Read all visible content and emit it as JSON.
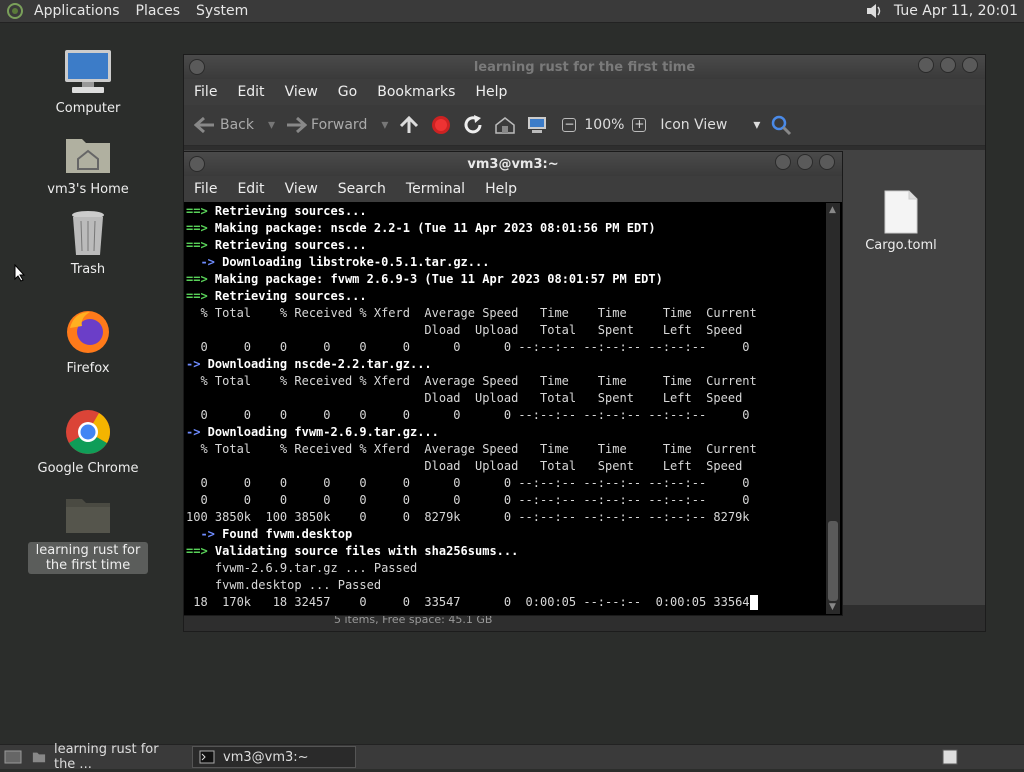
{
  "top_panel": {
    "menus": [
      "Applications",
      "Places",
      "System"
    ],
    "clock": "Tue Apr 11, 20:01"
  },
  "desktop": {
    "icons": [
      {
        "label": "Computer"
      },
      {
        "label": "vm3's Home"
      },
      {
        "label": "Trash"
      },
      {
        "label": "Firefox"
      },
      {
        "label": "Google Chrome"
      },
      {
        "label": "learning rust for the first time"
      }
    ]
  },
  "file_manager": {
    "title": "learning rust for the first time",
    "menu": [
      "File",
      "Edit",
      "View",
      "Go",
      "Bookmarks",
      "Help"
    ],
    "toolbar": {
      "back": "Back",
      "forward": "Forward",
      "zoom": "100%",
      "view_mode": "Icon View"
    },
    "files": [
      {
        "name": "Cargo.toml"
      }
    ],
    "status": "5 items, Free space: 45.1 GB"
  },
  "terminal": {
    "title": "vm3@vm3:~",
    "menu": [
      "File",
      "Edit",
      "View",
      "Search",
      "Terminal",
      "Help"
    ],
    "lines": [
      {
        "prefix": "==>",
        "style": "g",
        "text": " Retrieving sources...",
        "bold": true
      },
      {
        "prefix": "==>",
        "style": "g",
        "text": " Making package: nscde 2.2-1 (Tue 11 Apr 2023 08:01:56 PM EDT)",
        "bold": true
      },
      {
        "prefix": "==>",
        "style": "g",
        "text": " Retrieving sources...",
        "bold": true
      },
      {
        "prefix": "  ->",
        "style": "b",
        "text": " Downloading libstroke-0.5.1.tar.gz...",
        "bold": true
      },
      {
        "prefix": "==>",
        "style": "g",
        "text": " Making package: fvwm 2.6.9-3 (Tue 11 Apr 2023 08:01:57 PM EDT)",
        "bold": true
      },
      {
        "prefix": "==>",
        "style": "g",
        "text": " Retrieving sources...",
        "bold": true
      },
      {
        "prefix": "",
        "style": "",
        "text": "  % Total    % Received % Xferd  Average Speed   Time    Time     Time  Current",
        "bold": false
      },
      {
        "prefix": "",
        "style": "",
        "text": "                                 Dload  Upload   Total   Spent    Left  Speed",
        "bold": false
      },
      {
        "prefix": "",
        "style": "",
        "text": "  0     0    0     0    0     0      0      0 --:--:-- --:--:-- --:--:--     0",
        "bold": false
      },
      {
        "prefix": "->",
        "style": "b",
        "text": " Downloading nscde-2.2.tar.gz...",
        "bold": true
      },
      {
        "prefix": "",
        "style": "",
        "text": "  % Total    % Received % Xferd  Average Speed   Time    Time     Time  Current",
        "bold": false
      },
      {
        "prefix": "",
        "style": "",
        "text": "                                 Dload  Upload   Total   Spent    Left  Speed",
        "bold": false
      },
      {
        "prefix": "",
        "style": "",
        "text": "  0     0    0     0    0     0      0      0 --:--:-- --:--:-- --:--:--     0",
        "bold": false
      },
      {
        "prefix": "->",
        "style": "b",
        "text": " Downloading fvwm-2.6.9.tar.gz...",
        "bold": true
      },
      {
        "prefix": "",
        "style": "",
        "text": "  % Total    % Received % Xferd  Average Speed   Time    Time     Time  Current",
        "bold": false
      },
      {
        "prefix": "",
        "style": "",
        "text": "                                 Dload  Upload   Total   Spent    Left  Speed",
        "bold": false
      },
      {
        "prefix": "",
        "style": "",
        "text": "  0     0    0     0    0     0      0      0 --:--:-- --:--:-- --:--:--     0",
        "bold": false
      },
      {
        "prefix": "",
        "style": "",
        "text": "  0     0    0     0    0     0      0      0 --:--:-- --:--:-- --:--:--     0",
        "bold": false
      },
      {
        "prefix": "",
        "style": "",
        "text": "100 3850k  100 3850k    0     0  8279k      0 --:--:-- --:--:-- --:--:-- 8279k",
        "bold": false
      },
      {
        "prefix": "  ->",
        "style": "b",
        "text": " Found fvwm.desktop",
        "bold": true
      },
      {
        "prefix": "==>",
        "style": "g",
        "text": " Validating source files with sha256sums...",
        "bold": true
      },
      {
        "prefix": "",
        "style": "",
        "text": "    fvwm-2.6.9.tar.gz ... Passed",
        "bold": false
      },
      {
        "prefix": "",
        "style": "",
        "text": "    fvwm.desktop ... Passed",
        "bold": false
      },
      {
        "prefix": "",
        "style": "",
        "text": " 18  170k   18 32457    0     0  33547      0  0:00:05 --:--:--  0:00:05 33564",
        "bold": false,
        "cursor": true
      }
    ]
  },
  "taskbar": {
    "tasks": [
      {
        "label": "learning rust for the ...",
        "active": false
      },
      {
        "label": "vm3@vm3:~",
        "active": true
      }
    ]
  }
}
